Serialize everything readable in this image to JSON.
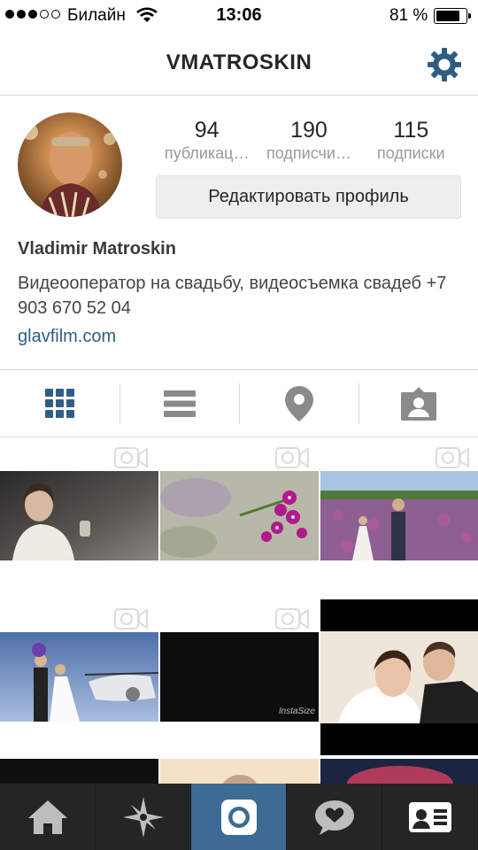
{
  "status_bar": {
    "carrier": "Билайн",
    "time": "13:06",
    "battery_percent": "81 %",
    "battery_level": 0.81
  },
  "header": {
    "title": "VMATROSKIN",
    "settings_icon": "gear-icon"
  },
  "profile": {
    "stats": [
      {
        "number": "94",
        "label": "публикац…"
      },
      {
        "number": "190",
        "label": "подписчи…"
      },
      {
        "number": "115",
        "label": "подписки"
      }
    ],
    "edit_button": "Редактировать профиль",
    "name": "Vladimir Matroskin",
    "bio": "Видеооператор на свадьбу, видеосъемка свадеб +7 903 670 52 04",
    "website": "glavfilm.com"
  },
  "tabs": [
    {
      "icon": "grid-view-icon",
      "active": true
    },
    {
      "icon": "list-view-icon",
      "active": false
    },
    {
      "icon": "map-pin-icon",
      "active": false
    },
    {
      "icon": "tagged-photos-icon",
      "active": false
    }
  ],
  "grid": {
    "watermark": "InstaSize",
    "items": [
      {
        "type": "video"
      },
      {
        "type": "video"
      },
      {
        "type": "video"
      },
      {
        "type": "video"
      },
      {
        "type": "video"
      },
      {
        "type": "photo"
      }
    ]
  },
  "bottom_nav": [
    {
      "icon": "home-icon",
      "active": false
    },
    {
      "icon": "explore-star-icon",
      "active": false
    },
    {
      "icon": "camera-icon",
      "active": true
    },
    {
      "icon": "activity-heart-bubble-icon",
      "active": false
    },
    {
      "icon": "profile-card-icon",
      "active": false
    }
  ],
  "colors": {
    "accent": "#3d6b93",
    "link": "#2e5e86",
    "nav_bg": "#252525",
    "tab_icon": "#2e5e86",
    "tab_icon_inactive": "#8a8a8a"
  }
}
